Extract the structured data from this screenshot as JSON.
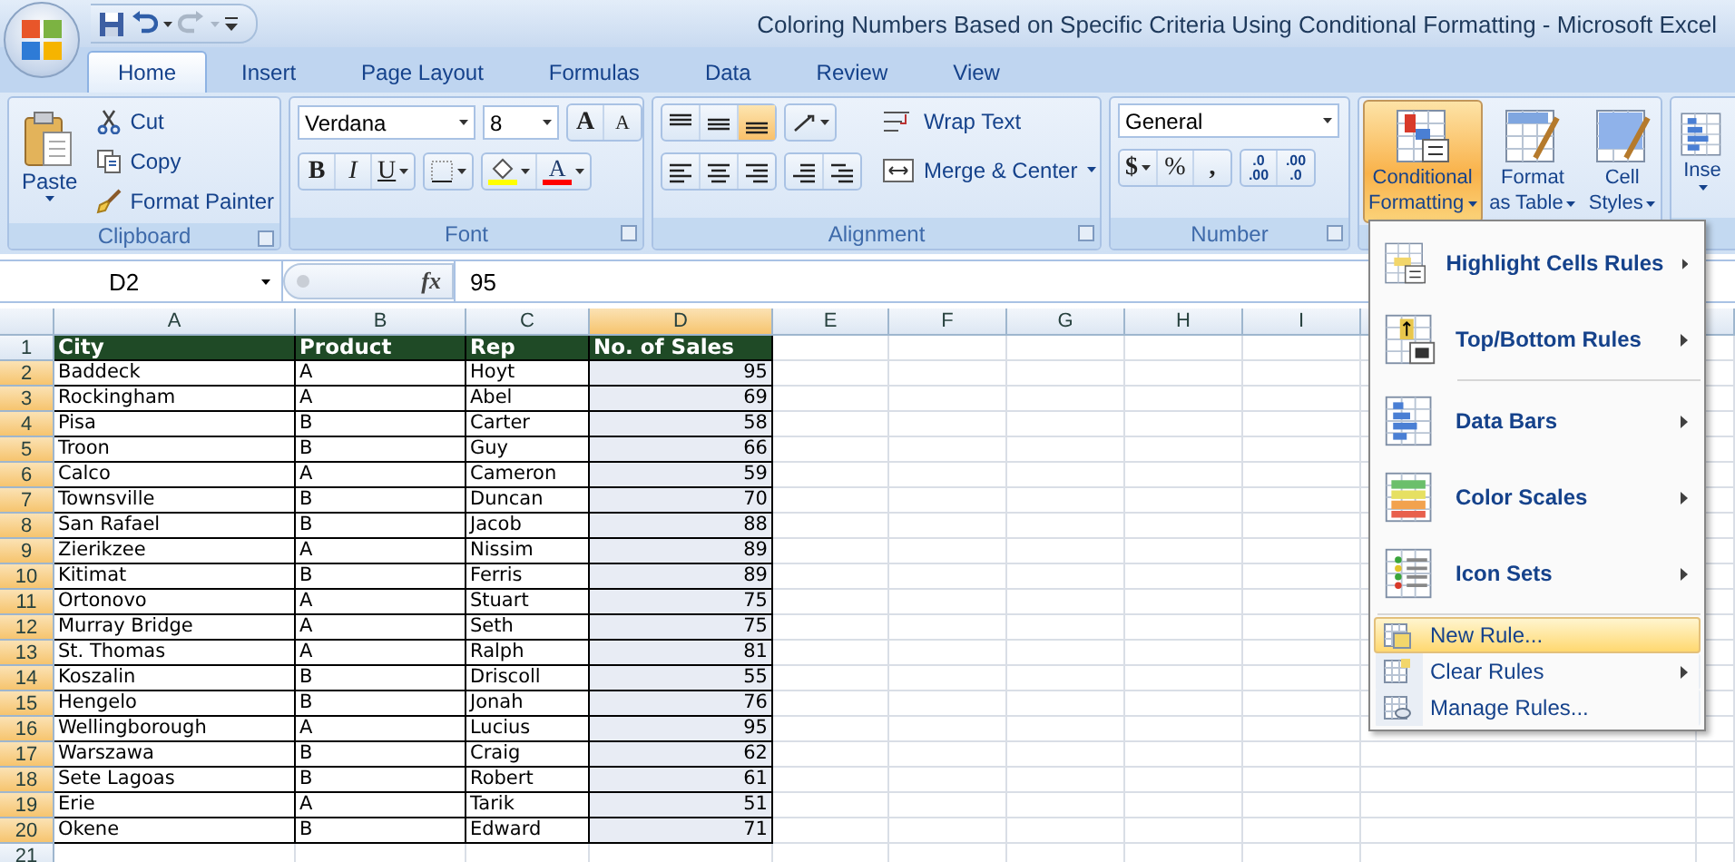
{
  "window": {
    "title": "Coloring Numbers Based on Specific Criteria Using Conditional Formatting - Microsoft Excel"
  },
  "tabs": [
    {
      "label": "Home",
      "selected": true
    },
    {
      "label": "Insert",
      "selected": false
    },
    {
      "label": "Page Layout",
      "selected": false
    },
    {
      "label": "Formulas",
      "selected": false
    },
    {
      "label": "Data",
      "selected": false
    },
    {
      "label": "Review",
      "selected": false
    },
    {
      "label": "View",
      "selected": false
    }
  ],
  "ribbon": {
    "clipboard": {
      "label": "Clipboard",
      "paste": "Paste",
      "cut": "Cut",
      "copy": "Copy",
      "format_painter": "Format Painter"
    },
    "font": {
      "label": "Font",
      "name": "Verdana",
      "size": "8",
      "grow": "A",
      "shrink": "A",
      "bold": "B",
      "italic": "I",
      "underline": "U",
      "color_letter": "A"
    },
    "alignment": {
      "label": "Alignment",
      "vertical": [
        {
          "selected": false
        },
        {
          "selected": false
        },
        {
          "selected": true
        }
      ],
      "wrap_text": "Wrap Text",
      "merge_center": "Merge & Center"
    },
    "number": {
      "label": "Number",
      "format": "General",
      "currency": "$",
      "percent": "%",
      "comma": ",",
      "decimals": [
        {
          "top": ".0",
          "bottom": ".00"
        },
        {
          "top": ".00",
          "bottom": ".0"
        }
      ]
    },
    "styles": {
      "buttons": [
        {
          "lines": [
            "Conditional",
            "Formatting"
          ],
          "selected": true
        },
        {
          "lines": [
            "Format",
            "as Table"
          ],
          "selected": false
        },
        {
          "lines": [
            "Cell",
            "Styles"
          ],
          "selected": false
        }
      ]
    },
    "cells": {
      "insert": "Inse"
    }
  },
  "formula_bar": {
    "name_box": "D2",
    "function_label": "fx",
    "value": "95"
  },
  "sheet": {
    "columns": [
      {
        "label": "A",
        "selected": false,
        "numeric": false
      },
      {
        "label": "B",
        "selected": false,
        "numeric": false
      },
      {
        "label": "C",
        "selected": false,
        "numeric": false
      },
      {
        "label": "D",
        "selected": true,
        "numeric": true
      },
      {
        "label": "E",
        "selected": false
      },
      {
        "label": "F",
        "selected": false
      },
      {
        "label": "G",
        "selected": false
      },
      {
        "label": "H",
        "selected": false
      },
      {
        "label": "I",
        "selected": false
      }
    ],
    "rows": [
      {
        "number": "1",
        "kind": "header",
        "selected": false,
        "cells": [
          "City",
          "Product",
          "Rep",
          "No. of Sales"
        ]
      },
      {
        "number": "2",
        "kind": "data",
        "selected": true,
        "cells": [
          "Baddeck",
          "A",
          "Hoyt",
          "95"
        ]
      },
      {
        "number": "3",
        "kind": "data",
        "selected": true,
        "cells": [
          "Rockingham",
          "A",
          "Abel",
          "69"
        ]
      },
      {
        "number": "4",
        "kind": "data",
        "selected": true,
        "cells": [
          "Pisa",
          "B",
          "Carter",
          "58"
        ]
      },
      {
        "number": "5",
        "kind": "data",
        "selected": true,
        "cells": [
          "Troon",
          "B",
          "Guy",
          "66"
        ]
      },
      {
        "number": "6",
        "kind": "data",
        "selected": true,
        "cells": [
          "Calco",
          "A",
          "Cameron",
          "59"
        ]
      },
      {
        "number": "7",
        "kind": "data",
        "selected": true,
        "cells": [
          "Townsville",
          "B",
          "Duncan",
          "70"
        ]
      },
      {
        "number": "8",
        "kind": "data",
        "selected": true,
        "cells": [
          "San Rafael",
          "B",
          "Jacob",
          "88"
        ]
      },
      {
        "number": "9",
        "kind": "data",
        "selected": true,
        "cells": [
          "Zierikzee",
          "A",
          "Nissim",
          "89"
        ]
      },
      {
        "number": "10",
        "kind": "data",
        "selected": true,
        "cells": [
          "Kitimat",
          "B",
          "Ferris",
          "89"
        ]
      },
      {
        "number": "11",
        "kind": "data",
        "selected": true,
        "cells": [
          "Ortonovo",
          "A",
          "Stuart",
          "75"
        ]
      },
      {
        "number": "12",
        "kind": "data",
        "selected": true,
        "cells": [
          "Murray Bridge",
          "A",
          "Seth",
          "75"
        ]
      },
      {
        "number": "13",
        "kind": "data",
        "selected": true,
        "cells": [
          "St. Thomas",
          "A",
          "Ralph",
          "81"
        ]
      },
      {
        "number": "14",
        "kind": "data",
        "selected": true,
        "cells": [
          "Koszalin",
          "B",
          "Driscoll",
          "55"
        ]
      },
      {
        "number": "15",
        "kind": "data",
        "selected": true,
        "cells": [
          "Hengelo",
          "B",
          "Jonah",
          "76"
        ]
      },
      {
        "number": "16",
        "kind": "data",
        "selected": true,
        "cells": [
          "Wellingborough",
          "A",
          "Lucius",
          "95"
        ]
      },
      {
        "number": "17",
        "kind": "data",
        "selected": true,
        "cells": [
          "Warszawa",
          "B",
          "Craig",
          "62"
        ]
      },
      {
        "number": "18",
        "kind": "data",
        "selected": true,
        "cells": [
          "Sete Lagoas",
          "B",
          "Robert",
          "61"
        ]
      },
      {
        "number": "19",
        "kind": "data",
        "selected": true,
        "cells": [
          "Erie",
          "A",
          "Tarik",
          "51"
        ]
      },
      {
        "number": "20",
        "kind": "data",
        "selected": true,
        "cells": [
          "Okene",
          "B",
          "Edward",
          "71"
        ]
      },
      {
        "number": "21",
        "selected": false
      }
    ]
  },
  "menu": {
    "items": [
      {
        "label": "Highlight Cells Rules",
        "kind": "large",
        "submenu": true,
        "selected": false,
        "separator_after": false
      },
      {
        "label": "Top/Bottom Rules",
        "kind": "large",
        "submenu": true,
        "selected": false,
        "separator_after": true
      },
      {
        "label": "Data Bars",
        "kind": "large",
        "submenu": true,
        "selected": false,
        "separator_after": false
      },
      {
        "label": "Color Scales",
        "kind": "large",
        "submenu": true,
        "selected": false,
        "separator_after": false
      },
      {
        "label": "Icon Sets",
        "kind": "large",
        "submenu": true,
        "selected": false,
        "separator_after": true
      },
      {
        "label": "New Rule...",
        "kind": "small",
        "submenu": false,
        "selected": true,
        "separator_after": false
      },
      {
        "label": "Clear Rules",
        "kind": "small",
        "submenu": true,
        "selected": false,
        "separator_after": false
      },
      {
        "label": "Manage Rules...",
        "kind": "small",
        "submenu": false,
        "selected": false,
        "separator_after": false
      }
    ]
  }
}
